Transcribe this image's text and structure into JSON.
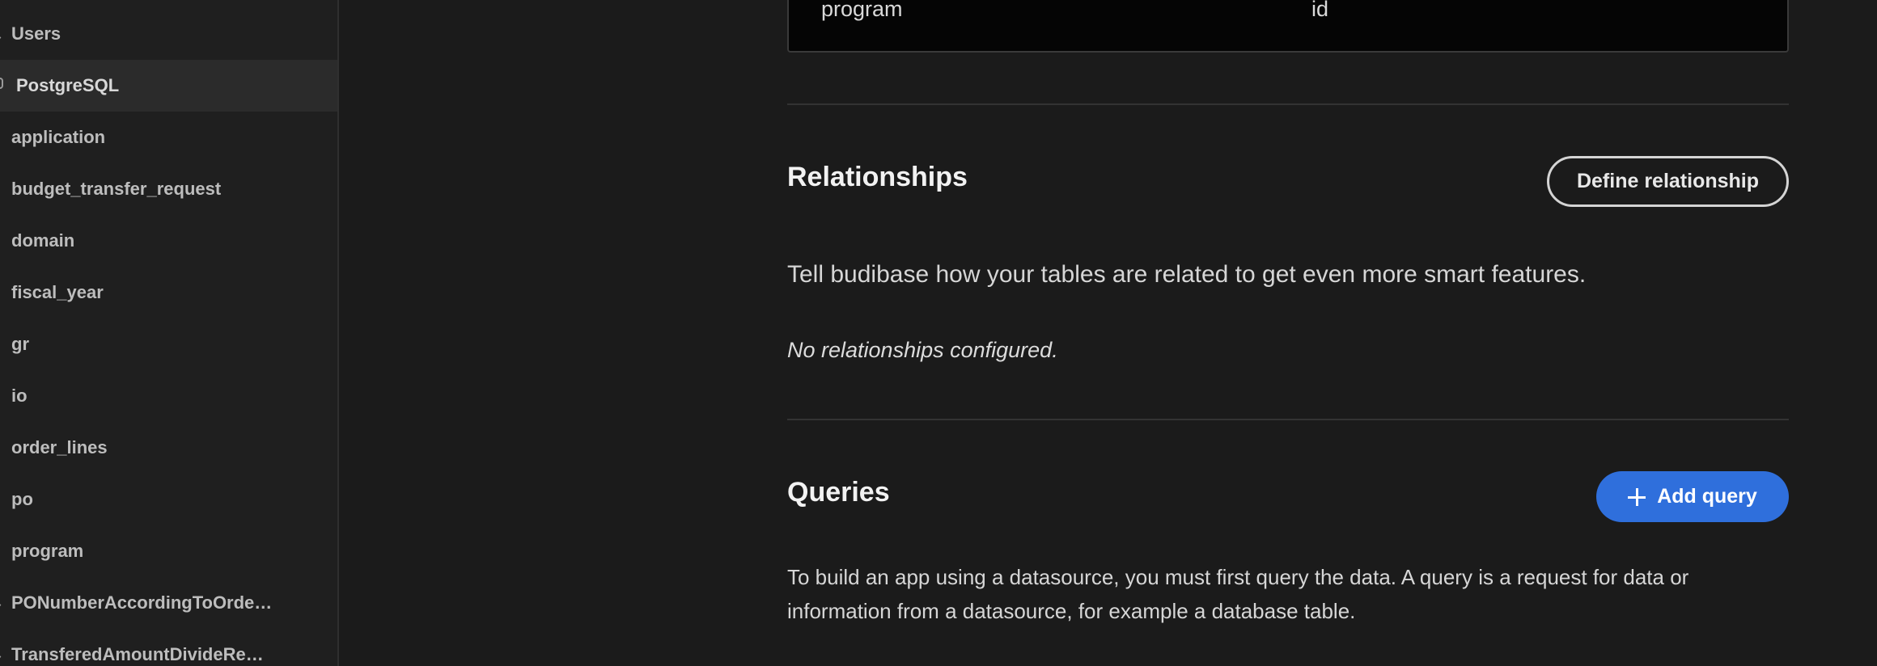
{
  "sidebar": {
    "items": [
      {
        "label": "Users",
        "icon": "user-icon"
      },
      {
        "label": "PostgreSQL",
        "icon": "database-icon",
        "selected": true
      },
      {
        "label": "application",
        "icon": "table-icon"
      },
      {
        "label": "budget_transfer_request",
        "icon": "table-icon"
      },
      {
        "label": "domain",
        "icon": "table-icon"
      },
      {
        "label": "fiscal_year",
        "icon": "table-icon"
      },
      {
        "label": "gr",
        "icon": "table-icon"
      },
      {
        "label": "io",
        "icon": "table-icon"
      },
      {
        "label": "order_lines",
        "icon": "table-icon"
      },
      {
        "label": "po",
        "icon": "table-icon"
      },
      {
        "label": "program",
        "icon": "table-icon"
      },
      {
        "label": "PONumberAccordingToOrde…",
        "icon": "view-icon"
      },
      {
        "label": "TransferedAmountDivideRe…",
        "icon": "view-icon"
      }
    ]
  },
  "schema_row": {
    "table": "program",
    "column": "id"
  },
  "relationships": {
    "title": "Relationships",
    "define_button": "Define relationship",
    "description": "Tell budibase how your tables are related to get even more smart features.",
    "empty_text": "No relationships configured."
  },
  "queries": {
    "title": "Queries",
    "add_button": "Add query",
    "description_line1": "To build an app using a datasource, you must first query the data. A query is a request for data or",
    "description_line2": "information from a datasource, for example a database table."
  },
  "colors": {
    "primary": "#2f6fdc",
    "background": "#1b1b1b",
    "sidebar": "#1f1f1f"
  }
}
